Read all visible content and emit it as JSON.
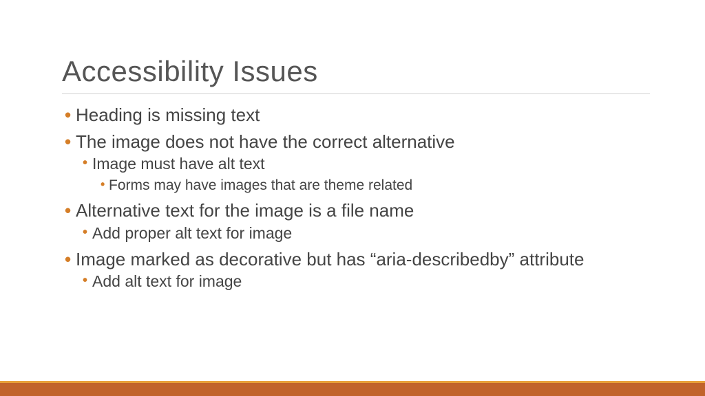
{
  "title": "Accessibility Issues",
  "bullets": {
    "b1": "Heading is missing text",
    "b2": "The image does not have the correct alternative",
    "b2a": "Image must have alt text",
    "b2a1": "Forms may have images that are theme related",
    "b3": "Alternative text for the image is a file name",
    "b3a": "Add proper alt text for image",
    "b4": "Image marked as decorative but has “aria-describedby” attribute",
    "b4a": "Add alt text for image"
  },
  "colors": {
    "bullet": "#d57e27",
    "footer_top": "#e8a13a",
    "footer_main": "#c1632b"
  }
}
